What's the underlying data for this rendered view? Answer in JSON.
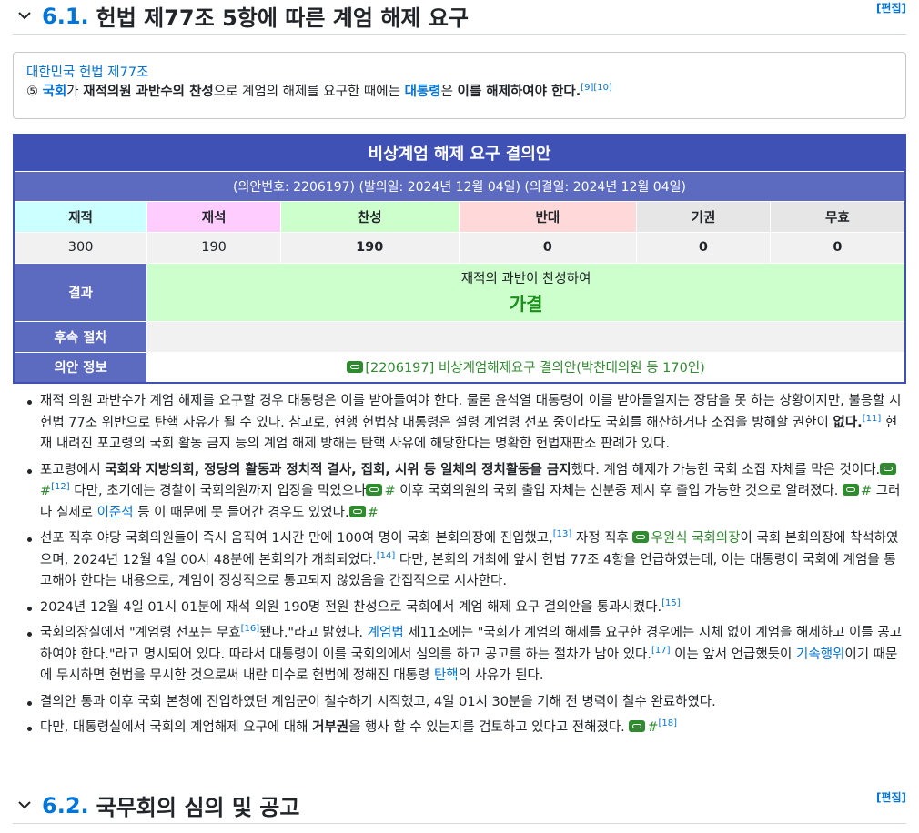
{
  "section1": {
    "number": "6.1.",
    "title": "헌법 제77조 5항에 따른 계엄 해제 요구",
    "edit": "[편집]"
  },
  "quote": {
    "title": "대한민국 헌법 제77조",
    "marker": "⑤",
    "t1": "국회",
    "t2": "가 ",
    "t3": "재적의원 과반수의 찬성",
    "t4": "으로 계엄의 해제를 요구한 때에는 ",
    "t5": "대통령",
    "t6": "은 ",
    "t7": "이를 해제하여야 한다.",
    "ref": "[9][10]"
  },
  "vote": {
    "title": "비상계엄 해제 요구 결의안",
    "subtitle": "(의안번호: 2206197) (발의일: 2024년 12월 04일) (의결일: 2024년 12월 04일)",
    "headers": [
      "재적",
      "재석",
      "찬성",
      "반대",
      "기권",
      "무효"
    ],
    "header_colors": [
      "#ccffff",
      "#ffccff",
      "#ccffcc",
      "#ffd9d9",
      "#e6e6e6",
      "#e6e6e6"
    ],
    "values": [
      "300",
      "190",
      "190",
      "0",
      "0",
      "0"
    ],
    "result_label": "결과",
    "result_text": "재적의 과반이 찬성하여",
    "result_big": "가결",
    "followup_label": "후속 절차",
    "info_label": "의안 정보",
    "info_text": "[2206197] 비상계엄해제요구 결의안(박찬대의원 등 170인)"
  },
  "bullets": {
    "b1": {
      "p1": "재적 의원 과반수가 계엄 해제를 요구할 경우 대통령은 이를 받아들여야 한다. 물론 윤석열 대통령이 이를 받아들일지는 장담을 못 하는 상황이지만, 불응할 시 헌법 77조 위반으로 탄핵 사유가 될 수 있다. 참고로, 현행 헌법상 대통령은 설령 계엄령 선포 중이라도 국회를 해산하거나 소집을 방해할 권한이 ",
      "p2": "없다.",
      "ref": "[11]",
      "p3": " 현재 내려진 포고령의 국회 활동 금지 등의 계엄 해제 방해는 탄핵 사유에 해당한다는 명확한 헌법재판소 판례가 있다."
    },
    "b2": {
      "p1": "포고령에서 ",
      "p2": "국회와 지방의회, 정당의 활동과 정치적 결사, 집회, 시위 등 일체의 정치활동을 금지",
      "p3": "했다. 계엄 해제가 가능한 국회 소집 자체를 막은 것이다.",
      "hash": "#",
      "ref": "[12]",
      "p4": " 다만, 초기에는 경찰이 국회의원까지 입장을 막았으나",
      "p5": " 이후 국회의원의 국회 출입 자체는 신분증 제시 후 출입 가능한 것으로 알려졌다. ",
      "p6": " 그러나 실제로 ",
      "p7": "이준석",
      "p8": " 등 이 때문에 못 들어간 경우도 있었다."
    },
    "b3": {
      "p1": "선포 직후 야당 국회의원들이 즉시 움직여 1시간 만에 100여 명이 국회 본회의장에 진입했고,",
      "ref1": "[13]",
      "p2": " 자정 직후 ",
      "p3": "우원식 국회의장",
      "p4": "이 국회 본회의장에 착석하였으며, 2024년 12월 4일 00시 48분에 본회의가 개최되었다.",
      "ref2": "[14]",
      "p5": " 다만, 본회의 개최에 앞서 헌법 77조 4항을 언급하였는데, 이는 대통령이 국회에 계엄을 통고해야 한다는 내용으로, 계엄이 정상적으로 통고되지 않았음을 간접적으로 시사한다."
    },
    "b4": {
      "p1": "2024년 12월 4일 01시 01분에 재석 의원 190명 전원 찬성으로 국회에서 계엄 해제 요구 결의안을 통과시켰다.",
      "ref": "[15]"
    },
    "b5": {
      "p1": "국회의장실에서 \"계엄령 선포는 무효",
      "ref1": "[16]",
      "p2": "됐다.\"라고 밝혔다. ",
      "p3": "계엄법",
      "p4": " 제11조에는 \"국회가 계엄의 해제를 요구한 경우에는 지체 없이 계엄을 해제하고 이를 공고하여야 한다.\"라고 명시되어 있다. 따라서 대통령이 이를 국회의에서 심의를 하고 공고를 하는 절차가 남아 있다.",
      "ref2": "[17]",
      "p5": " 이는 앞서 언급했듯이 ",
      "p6": "기속행위",
      "p7": "이기 때문에 무시하면 헌법을 무시한 것으로써 내란 미수로 헌법에 정해진 대통령 ",
      "p8": "탄핵",
      "p9": "의 사유가 된다."
    },
    "b6": {
      "p1": "결의안 통과 이후 국회 본청에 진입하였던 계엄군이 철수하기 시작했고, 4일 01시 30분을 기해 전 병력이 철수 완료하였다."
    },
    "b7": {
      "p1": "다만, 대통령실에서 국회의 계엄해제 요구에 대해 ",
      "p2": "거부권",
      "p3": "을 행사 할 수 있는지를 검토하고 있다고 전해졌다. ",
      "ref": "[18]"
    }
  },
  "section2": {
    "number": "6.2.",
    "title": "국무회의 심의 및 공고",
    "edit": "[편집]"
  }
}
